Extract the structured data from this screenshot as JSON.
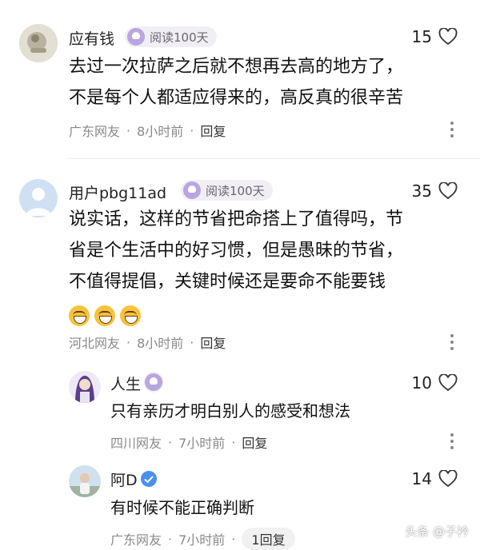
{
  "comments": [
    {
      "username": "应有钱",
      "badge": "阅读100天",
      "likes": "15",
      "lines": [
        "去过一次拉萨之后就不想再去高的地方了，",
        "不是每个人都适应得来的，高反真的很辛苦"
      ],
      "location": "广东网友",
      "time": "8小时前",
      "reply": "回复"
    },
    {
      "username": "用户pbg11ad",
      "badge": "阅读100天",
      "likes": "35",
      "lines": [
        "说实话，这样的节省把命搭上了值得吗，节",
        "省是个生活中的好习惯，但是愚昧的节省，",
        "不值得提倡，关键时候还是要命不能要钱"
      ],
      "location": "河北网友",
      "time": "8小时前",
      "reply": "回复",
      "replies": [
        {
          "username": "人生",
          "likes": "10",
          "text": "只有亲历才明白别人的感受和想法",
          "location": "四川网友",
          "time": "7小时前",
          "reply": "回复"
        },
        {
          "username": "阿D",
          "likes": "14",
          "text": "有时候不能正确判断",
          "location": "广东网友",
          "time": "7小时前",
          "reply": "1回复"
        }
      ]
    }
  ],
  "separator": "·",
  "watermark": "头条 @子衿",
  "icons": {
    "like": "heart-outline-icon",
    "more": "more-vertical-icon",
    "badge": "reading-badge-icon",
    "emoji": "laugh-cry-emoji-icon"
  },
  "colors": {
    "badge_bg": "#f1eff3",
    "badge_icon": "#b9a6e0",
    "meta": "#8a8a8a"
  }
}
